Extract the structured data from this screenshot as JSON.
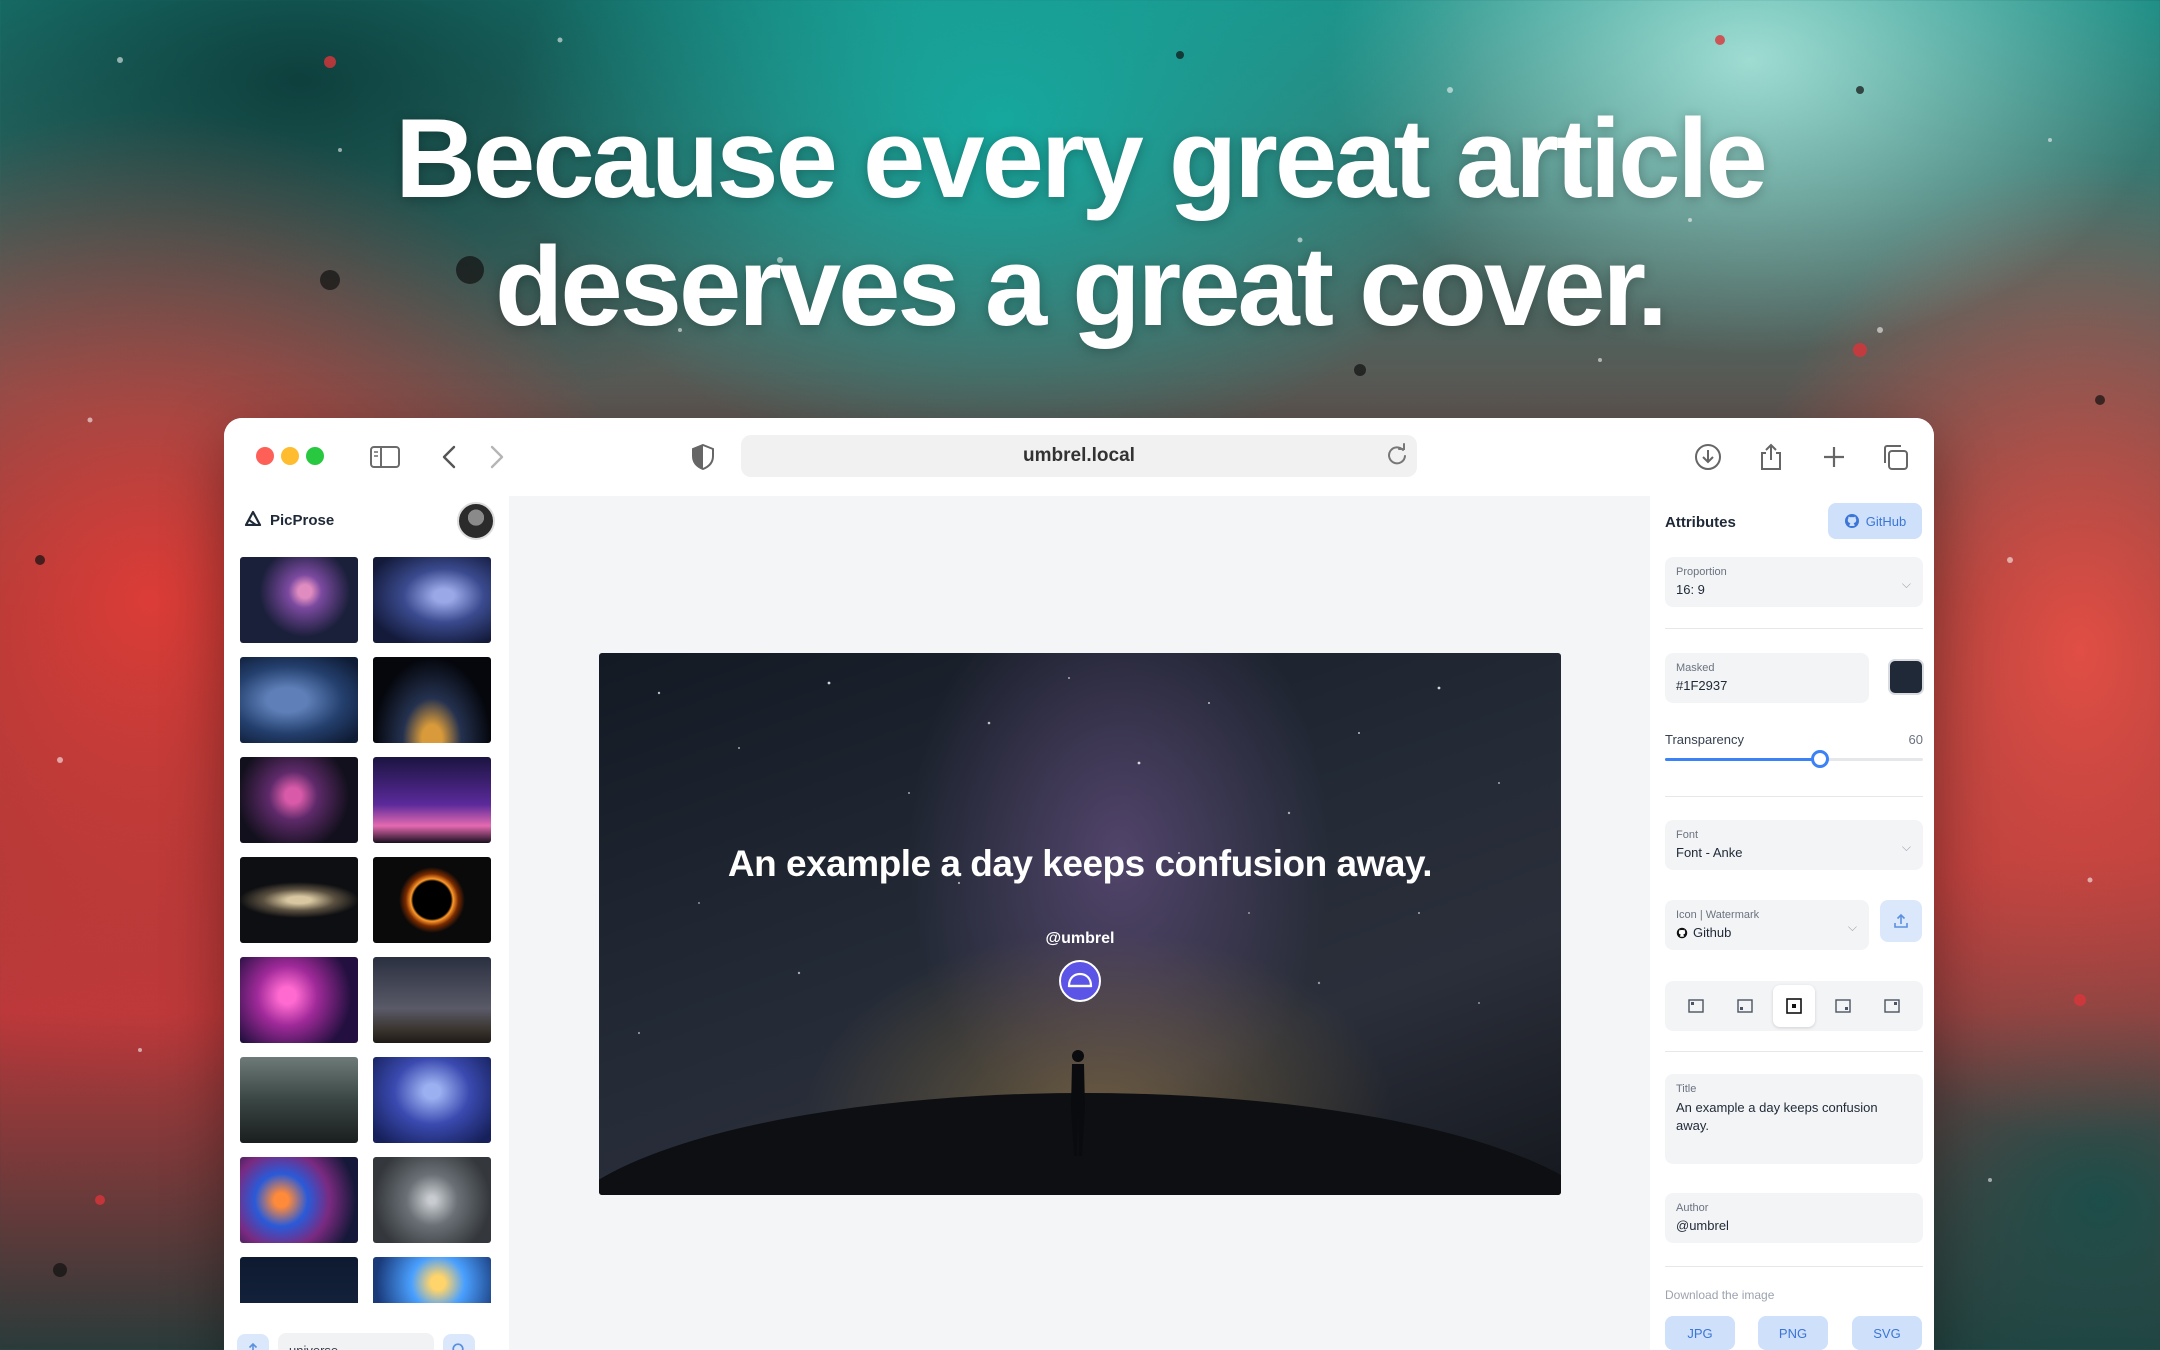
{
  "hero": {
    "line1": "Because every great article",
    "line2": "deserves a great cover."
  },
  "browser": {
    "url": "umbrel.local"
  },
  "app": {
    "name": "PicProse",
    "search_value": "universe",
    "thumbnail_subjects": [
      "milky-way-silhouette",
      "nebula-blue",
      "starfield-blue",
      "earth-night-lights",
      "orion-nebula",
      "purple-sky-horizon",
      "andromeda-galaxy",
      "solar-eclipse",
      "pink-nebula",
      "milky-way-rocks",
      "forest-starry-sky",
      "blue-milky-way",
      "colorful-nebula",
      "star-trails",
      "night-sky-dark",
      "galaxy-cluster"
    ]
  },
  "cover": {
    "title": "An example a day keeps confusion away.",
    "author": "@umbrel",
    "mask_color": "#1F2937"
  },
  "attributes": {
    "title": "Attributes",
    "github_button": "GitHub",
    "proportion": {
      "label": "Proportion",
      "value": "16: 9"
    },
    "masked": {
      "label": "Masked",
      "value": "#1F2937"
    },
    "transparency": {
      "label": "Transparency",
      "value": "60",
      "fraction": 0.6
    },
    "font": {
      "label": "Font",
      "value": "Font - Anke"
    },
    "icon_watermark": {
      "label": "Icon | Watermark",
      "value": "Github"
    },
    "position_options": [
      "top-left",
      "bottom-left",
      "center",
      "bottom-right",
      "top-right"
    ],
    "selected_position": "center",
    "title_field": {
      "label": "Title",
      "value": "An example a day keeps confusion away."
    },
    "author_field": {
      "label": "Author",
      "value": "@umbrel"
    },
    "download": {
      "label": "Download the image",
      "formats": [
        "JPG",
        "PNG",
        "SVG"
      ]
    }
  },
  "colors": {
    "accent": "#3B82F6",
    "button_bg": "#CFE0FB",
    "logo_purple": "#5B54E6"
  }
}
